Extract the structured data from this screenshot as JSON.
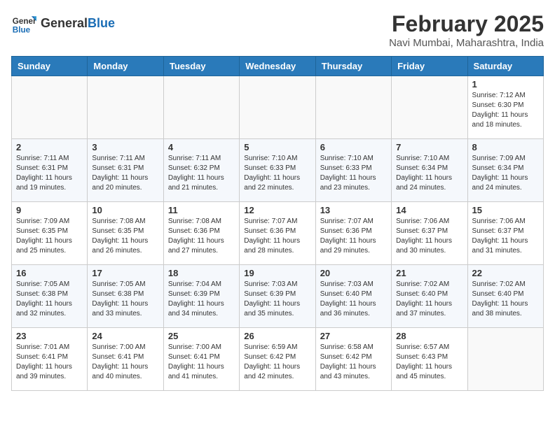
{
  "header": {
    "logo_general": "General",
    "logo_blue": "Blue",
    "month_year": "February 2025",
    "location": "Navi Mumbai, Maharashtra, India"
  },
  "weekdays": [
    "Sunday",
    "Monday",
    "Tuesday",
    "Wednesday",
    "Thursday",
    "Friday",
    "Saturday"
  ],
  "weeks": [
    [
      {
        "day": "",
        "info": ""
      },
      {
        "day": "",
        "info": ""
      },
      {
        "day": "",
        "info": ""
      },
      {
        "day": "",
        "info": ""
      },
      {
        "day": "",
        "info": ""
      },
      {
        "day": "",
        "info": ""
      },
      {
        "day": "1",
        "info": "Sunrise: 7:12 AM\nSunset: 6:30 PM\nDaylight: 11 hours and 18 minutes."
      }
    ],
    [
      {
        "day": "2",
        "info": "Sunrise: 7:11 AM\nSunset: 6:31 PM\nDaylight: 11 hours and 19 minutes."
      },
      {
        "day": "3",
        "info": "Sunrise: 7:11 AM\nSunset: 6:31 PM\nDaylight: 11 hours and 20 minutes."
      },
      {
        "day": "4",
        "info": "Sunrise: 7:11 AM\nSunset: 6:32 PM\nDaylight: 11 hours and 21 minutes."
      },
      {
        "day": "5",
        "info": "Sunrise: 7:10 AM\nSunset: 6:33 PM\nDaylight: 11 hours and 22 minutes."
      },
      {
        "day": "6",
        "info": "Sunrise: 7:10 AM\nSunset: 6:33 PM\nDaylight: 11 hours and 23 minutes."
      },
      {
        "day": "7",
        "info": "Sunrise: 7:10 AM\nSunset: 6:34 PM\nDaylight: 11 hours and 24 minutes."
      },
      {
        "day": "8",
        "info": "Sunrise: 7:09 AM\nSunset: 6:34 PM\nDaylight: 11 hours and 24 minutes."
      }
    ],
    [
      {
        "day": "9",
        "info": "Sunrise: 7:09 AM\nSunset: 6:35 PM\nDaylight: 11 hours and 25 minutes."
      },
      {
        "day": "10",
        "info": "Sunrise: 7:08 AM\nSunset: 6:35 PM\nDaylight: 11 hours and 26 minutes."
      },
      {
        "day": "11",
        "info": "Sunrise: 7:08 AM\nSunset: 6:36 PM\nDaylight: 11 hours and 27 minutes."
      },
      {
        "day": "12",
        "info": "Sunrise: 7:07 AM\nSunset: 6:36 PM\nDaylight: 11 hours and 28 minutes."
      },
      {
        "day": "13",
        "info": "Sunrise: 7:07 AM\nSunset: 6:36 PM\nDaylight: 11 hours and 29 minutes."
      },
      {
        "day": "14",
        "info": "Sunrise: 7:06 AM\nSunset: 6:37 PM\nDaylight: 11 hours and 30 minutes."
      },
      {
        "day": "15",
        "info": "Sunrise: 7:06 AM\nSunset: 6:37 PM\nDaylight: 11 hours and 31 minutes."
      }
    ],
    [
      {
        "day": "16",
        "info": "Sunrise: 7:05 AM\nSunset: 6:38 PM\nDaylight: 11 hours and 32 minutes."
      },
      {
        "day": "17",
        "info": "Sunrise: 7:05 AM\nSunset: 6:38 PM\nDaylight: 11 hours and 33 minutes."
      },
      {
        "day": "18",
        "info": "Sunrise: 7:04 AM\nSunset: 6:39 PM\nDaylight: 11 hours and 34 minutes."
      },
      {
        "day": "19",
        "info": "Sunrise: 7:03 AM\nSunset: 6:39 PM\nDaylight: 11 hours and 35 minutes."
      },
      {
        "day": "20",
        "info": "Sunrise: 7:03 AM\nSunset: 6:40 PM\nDaylight: 11 hours and 36 minutes."
      },
      {
        "day": "21",
        "info": "Sunrise: 7:02 AM\nSunset: 6:40 PM\nDaylight: 11 hours and 37 minutes."
      },
      {
        "day": "22",
        "info": "Sunrise: 7:02 AM\nSunset: 6:40 PM\nDaylight: 11 hours and 38 minutes."
      }
    ],
    [
      {
        "day": "23",
        "info": "Sunrise: 7:01 AM\nSunset: 6:41 PM\nDaylight: 11 hours and 39 minutes."
      },
      {
        "day": "24",
        "info": "Sunrise: 7:00 AM\nSunset: 6:41 PM\nDaylight: 11 hours and 40 minutes."
      },
      {
        "day": "25",
        "info": "Sunrise: 7:00 AM\nSunset: 6:41 PM\nDaylight: 11 hours and 41 minutes."
      },
      {
        "day": "26",
        "info": "Sunrise: 6:59 AM\nSunset: 6:42 PM\nDaylight: 11 hours and 42 minutes."
      },
      {
        "day": "27",
        "info": "Sunrise: 6:58 AM\nSunset: 6:42 PM\nDaylight: 11 hours and 43 minutes."
      },
      {
        "day": "28",
        "info": "Sunrise: 6:57 AM\nSunset: 6:43 PM\nDaylight: 11 hours and 45 minutes."
      },
      {
        "day": "",
        "info": ""
      }
    ]
  ]
}
